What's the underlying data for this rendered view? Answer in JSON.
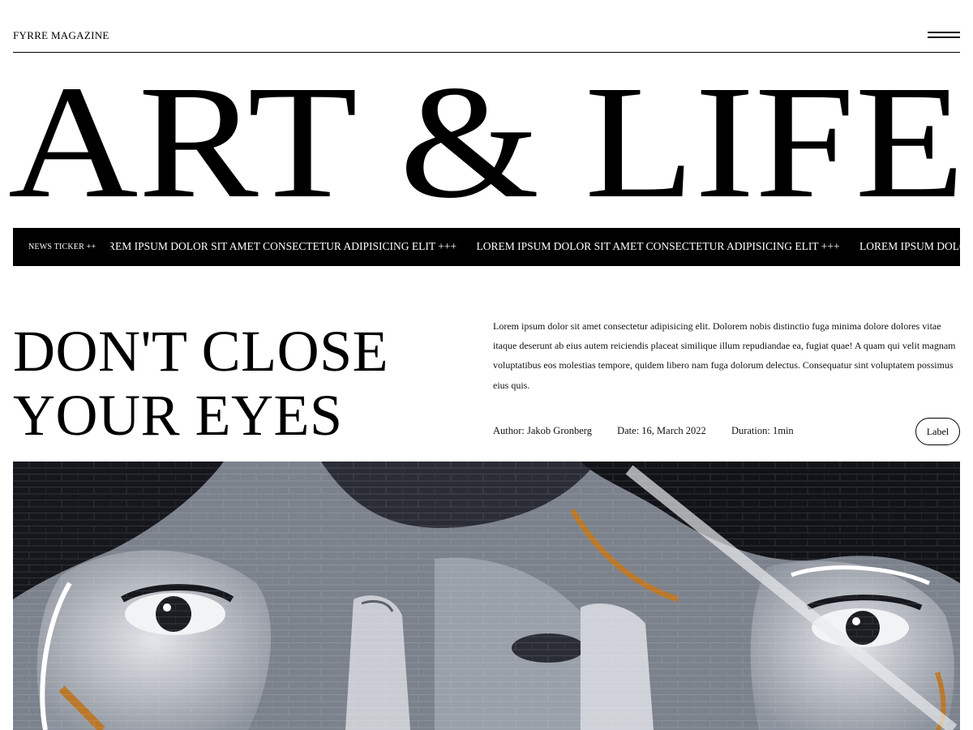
{
  "header": {
    "brand": "FYRRE MAGAZINE",
    "menu_icon": "hamburger-menu-icon"
  },
  "masthead": {
    "title": "ART & LIFE"
  },
  "ticker": {
    "label": "NEWS TICKER ++",
    "items": [
      "REM IPSUM DOLOR SIT AMET CONSECTETUR ADIPISICING ELIT +++",
      "LOREM IPSUM DOLOR SIT AMET CONSECTETUR ADIPISICING ELIT +++",
      "LOREM IPSUM DOLOR SIT AMET CONSECTETUR ADIPISICING ELIT +++"
    ]
  },
  "article": {
    "headline_line1": "DON'T CLOSE",
    "headline_line2": "YOUR EYES",
    "lead": "Lorem ipsum dolor sit amet consectetur adipisicing elit. Dolorem nobis distinctio fuga minima dolore dolores vitae itaque deserunt ab eius autem reiciendis placeat similique illum repudiandae ea, fugiat quae! A quam qui velit magnam voluptatibus eos molestias tempore, quidem libero nam fuga dolorum delectus. Consequatur sint voluptatem possimus eius quis.",
    "author": "Author: Jakob Gronberg",
    "date": "Date: 16, March 2022",
    "duration": "Duration: 1min",
    "label": "Label"
  },
  "hero": {
    "image": "street-art-mural-faces-image",
    "colors": {
      "dark": "#16181f",
      "mid": "#6f7682",
      "light": "#d4d7dc",
      "accent": "#b9782a"
    }
  }
}
